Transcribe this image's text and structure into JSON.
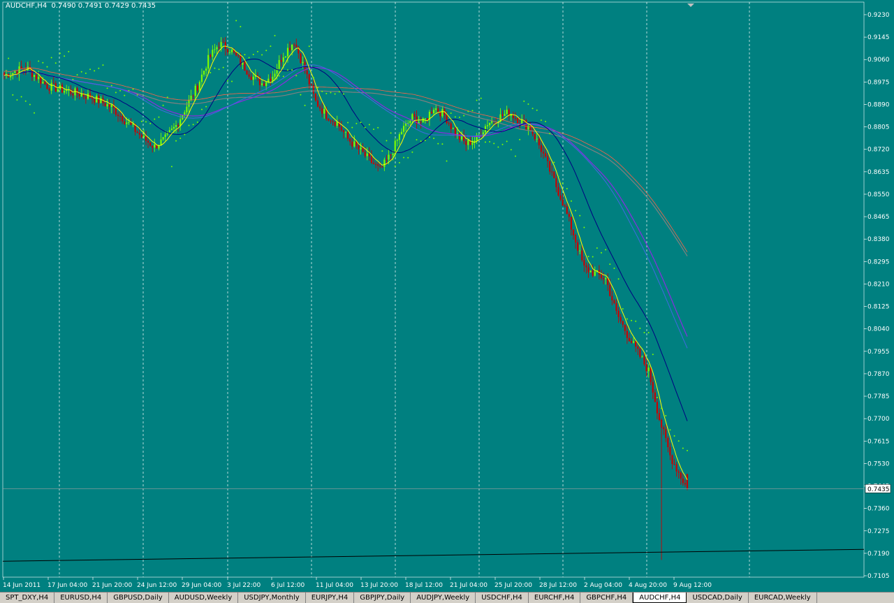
{
  "header": {
    "symbol": "AUDCHF,H4",
    "ohlc": "0.7490 0.7491 0.7429 0.7435"
  },
  "colors": {
    "background": "#008080",
    "bull": "#7cfc00",
    "bear": "#cc0000",
    "sma_fast": "#ffff00",
    "sma_mid": "#000080",
    "sma_slow_a": "#8a2be2",
    "sma_slow_b": "#4169e1",
    "sma_slowest": "#808080",
    "sma_slowest_b": "#ff6347",
    "psar": "#7cfc00",
    "long_trendline": "#000000",
    "grid": "#ffffff"
  },
  "chart_data": {
    "type": "candlestick",
    "title": "AUDCHF,H4",
    "ylim": [
      0.7105,
      0.923
    ],
    "y_ticks": [
      "0.9230",
      "0.9145",
      "0.9060",
      "0.8975",
      "0.8890",
      "0.8805",
      "0.8720",
      "0.8635",
      "0.8550",
      "0.8465",
      "0.8380",
      "0.8295",
      "0.8210",
      "0.8125",
      "0.8040",
      "0.7955",
      "0.7870",
      "0.7785",
      "0.7700",
      "0.7615",
      "0.7530",
      "0.7445",
      "0.7360",
      "0.7275",
      "0.7190",
      "0.7105"
    ],
    "x_ticks": [
      "14 Jun 2011",
      "17 Jun 04:00",
      "21 Jun 20:00",
      "24 Jun 12:00",
      "29 Jun 04:00",
      "3 Jul 22:00",
      "6 Jul 12:00",
      "11 Jul 04:00",
      "13 Jul 20:00",
      "18 Jul 12:00",
      "21 Jul 04:00",
      "25 Jul 20:00",
      "28 Jul 12:00",
      "2 Aug 04:00",
      "4 Aug 20:00",
      "9 Aug 12:00"
    ],
    "current_price": "0.7435",
    "last_bar": {
      "open": 0.749,
      "high": 0.7491,
      "low": 0.7429,
      "close": 0.7435
    },
    "close_path": [
      [
        0,
        0.9
      ],
      [
        10,
        0.903
      ],
      [
        20,
        0.896
      ],
      [
        30,
        0.894
      ],
      [
        40,
        0.892
      ],
      [
        50,
        0.888
      ],
      [
        60,
        0.88
      ],
      [
        65,
        0.876
      ],
      [
        70,
        0.873
      ],
      [
        75,
        0.876
      ],
      [
        80,
        0.881
      ],
      [
        90,
        0.896
      ],
      [
        95,
        0.906
      ],
      [
        100,
        0.912
      ],
      [
        105,
        0.91
      ],
      [
        110,
        0.905
      ],
      [
        115,
        0.9
      ],
      [
        120,
        0.897
      ],
      [
        125,
        0.9
      ],
      [
        130,
        0.908
      ],
      [
        135,
        0.913
      ],
      [
        140,
        0.902
      ],
      [
        145,
        0.89
      ],
      [
        150,
        0.885
      ],
      [
        155,
        0.882
      ],
      [
        160,
        0.876
      ],
      [
        165,
        0.872
      ],
      [
        170,
        0.868
      ],
      [
        175,
        0.864
      ],
      [
        180,
        0.87
      ],
      [
        185,
        0.879
      ],
      [
        190,
        0.884
      ],
      [
        195,
        0.882
      ],
      [
        200,
        0.888
      ],
      [
        205,
        0.885
      ],
      [
        210,
        0.878
      ],
      [
        215,
        0.874
      ],
      [
        220,
        0.876
      ],
      [
        225,
        0.882
      ],
      [
        230,
        0.884
      ],
      [
        235,
        0.886
      ],
      [
        240,
        0.883
      ],
      [
        245,
        0.88
      ],
      [
        250,
        0.872
      ],
      [
        255,
        0.862
      ],
      [
        260,
        0.852
      ],
      [
        265,
        0.84
      ],
      [
        270,
        0.827
      ],
      [
        275,
        0.825
      ],
      [
        280,
        0.823
      ],
      [
        285,
        0.81
      ],
      [
        290,
        0.802
      ],
      [
        295,
        0.795
      ],
      [
        300,
        0.788
      ],
      [
        305,
        0.77
      ],
      [
        310,
        0.756
      ],
      [
        315,
        0.748
      ],
      [
        318,
        0.7435
      ]
    ],
    "sma_fast_end": 0.753,
    "sma_mid_end": 0.787,
    "sma_slow_a_end": 0.821,
    "sma_slow_b_end": 0.8245,
    "sma_slowest_end": 0.849,
    "long_trendline": {
      "start": 0.716,
      "end": 0.7205
    }
  },
  "tabs": [
    {
      "label": "SPT_DXY,H4",
      "active": false
    },
    {
      "label": "EURUSD,H4",
      "active": false
    },
    {
      "label": "GBPUSD,Daily",
      "active": false
    },
    {
      "label": "AUDUSD,Weekly",
      "active": false
    },
    {
      "label": "USDJPY,Monthly",
      "active": false
    },
    {
      "label": "EURJPY,H4",
      "active": false
    },
    {
      "label": "GBPJPY,Daily",
      "active": false
    },
    {
      "label": "AUDJPY,Weekly",
      "active": false
    },
    {
      "label": "USDCHF,H4",
      "active": false
    },
    {
      "label": "EURCHF,H4",
      "active": false
    },
    {
      "label": "GBPCHF,H4",
      "active": false
    },
    {
      "label": "AUDCHF,H4",
      "active": true
    },
    {
      "label": "USDCAD,Daily",
      "active": false
    },
    {
      "label": "EURCAD,Weekly",
      "active": false
    }
  ]
}
